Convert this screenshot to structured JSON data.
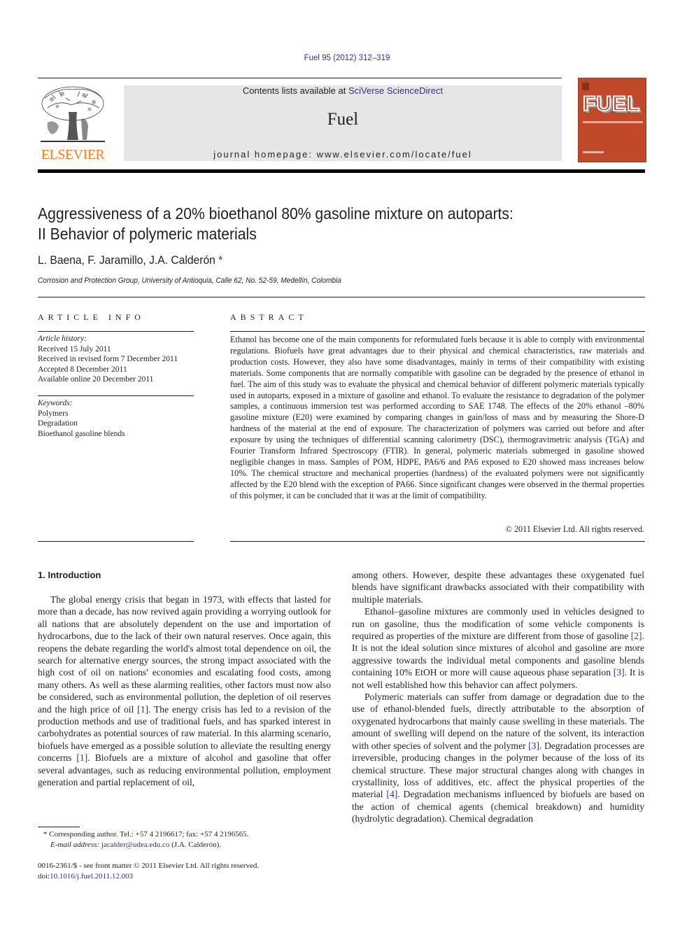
{
  "header": {
    "citation": "Fuel 95 (2012) 312–319",
    "contents_prefix": "Contents lists available at ",
    "contents_link": "SciVerse ScienceDirect",
    "journal_name": "Fuel",
    "homepage_prefix": "journal homepage: ",
    "homepage_url": "www.elsevier.com/locate/fuel",
    "publisher_logo_text": "ELSEVIER",
    "cover_title": "FUEL",
    "colors": {
      "publisher_orange": "#f58220",
      "cover_red": "#c0492a",
      "link_blue": "#2e3092"
    }
  },
  "article": {
    "title_line1": "Aggressiveness of a 20% bioethanol 80% gasoline mixture on autoparts:",
    "title_line2": "II Behavior of polymeric materials",
    "authors": "L. Baena, F. Jaramillo, J.A. Calderón",
    "author_mark": "*",
    "affiliation": "Corrosion and Protection Group, University of Antioquia, Calle 62, No. 52-59, Medellín, Colombia"
  },
  "article_info": {
    "heading": "ARTICLE INFO",
    "history_label": "Article history:",
    "history": [
      "Received 15 July 2011",
      "Received in revised form 7 December 2011",
      "Accepted 8 December 2011",
      "Available online 20 December 2011"
    ],
    "keywords_label": "Keywords:",
    "keywords": [
      "Polymers",
      "Degradation",
      "Bioethanol gasoline blends"
    ]
  },
  "abstract": {
    "heading": "ABSTRACT",
    "text": "Ethanol has become one of the main components for reformulated fuels because it is able to comply with environmental regulations. Biofuels have great advantages due to their physical and chemical characteristics, raw materials and production costs. However, they also have some disadvantages, mainly in terms of their compatibility with existing materials. Some components that are normally compatible with gasoline can be degraded by the presence of ethanol in fuel. The aim of this study was to evaluate the physical and chemical behavior of different polymeric materials typically used in autoparts, exposed in a mixture of gasoline and ethanol. To evaluate the resistance to degradation of the polymer samples, a continuous immersion test was performed according to SAE 1748. The effects of the 20% ethanol –80% gasoline mixture (E20) were examined by comparing changes in gain/loss of mass and by measuring the Shore-D hardness of the material at the end of exposure. The characterization of polymers was carried out before and after exposure by using the techniques of differential scanning calorimetry (DSC), thermogravimetric analysis (TGA) and Fourier Transform Infrared Spectroscopy (FTIR). In general, polymeric materials submerged in gasoline showed negligible changes in mass. Samples of POM, HDPE, PA6/6 and PA6 exposed to E20 showed mass increases below 10%. The chemical structure and mechanical properties (hardness) of the evaluated polymers were not significantly affected by the E20 blend with the exception of PA66. Since significant changes were observed in the thermal properties of this polymer, it can be concluded that it was at the limit of compatibility.",
    "copyright": "© 2011 Elsevier Ltd. All rights reserved."
  },
  "body": {
    "section_heading": "1. Introduction",
    "left_p1_a": "The global energy crisis that began in 1973, with effects that lasted for more than a decade, has now revived again providing a worrying outlook for all nations that are absolutely dependent on the use and importation of hydrocarbons, due to the lack of their own natural reserves. Once again, this reopens the debate regarding the world's almost total dependence on oil, the search for alternative energy sources, the strong impact associated with the high cost of oil on nations' economies and escalating food costs, among many others. As well as these alarming realities, other factors must now also be considered, such as environmental pollution, the depletion of oil reserves and the high price of oil ",
    "ref1": "[1]",
    "left_p1_b": ". The energy crisis has led to a revision of the production methods and use of traditional fuels, and has sparked interest in carbohydrates as potential sources of raw material. In this alarming scenario, biofuels have emerged as a possible solution to alleviate the resulting energy concerns ",
    "left_p1_c": ". Biofuels are a mixture of alcohol and gasoline that offer several advantages, such as reducing environmental pollution, employment generation and partial replacement of oil,",
    "right_p1": "among others. However, despite these advantages these oxygenated fuel blends have significant drawbacks associated with their compatibility with multiple materials.",
    "right_p2_a": "Ethanol–gasoline mixtures are commonly used in vehicles designed to run on gasoline, thus the modification of some vehicle components is required as properties of the mixture are different from those of gasoline ",
    "ref2": "[2]",
    "right_p2_b": ". It is not the ideal solution since mixtures of alcohol and gasoline are more aggressive towards the individual metal components and gasoline blends containing 10% EtOH or more will cause aqueous phase separation ",
    "ref3": "[3]",
    "right_p2_c": ". It is not well established how this behavior can affect polymers.",
    "right_p3_a": "Polymeric materials can suffer from damage or degradation due to the use of ethanol-blended fuels, directly attributable to the absorption of oxygenated hydrocarbons that mainly cause swelling in these materials. The amount of swelling will depend on the nature of the solvent, its interaction with other species of solvent and the polymer ",
    "right_p3_b": ". Degradation processes are irreversible, producing changes in the polymer because of the loss of its chemical structure. These major structural changes along with changes in crystallinity, loss of additives, etc. affect the physical properties of the material ",
    "ref4": "[4]",
    "right_p3_c": ". Degradation mechanisms influenced by biofuels are based on the action of chemical agents (chemical breakdown) and humidity (hydrolytic degradation). Chemical degradation"
  },
  "footnote": {
    "mark": "*",
    "corresponding": " Corresponding author. Tel.: +57 4 2196617; fax: +57 4 2196565.",
    "email_label": "E-mail address:",
    "email": "jacalder@udea.edu.co",
    "email_suffix": " (J.A. Calderón)."
  },
  "front_matter": {
    "issn_line": "0016-2361/$ - see front matter © 2011 Elsevier Ltd. All rights reserved.",
    "doi_prefix": "doi:",
    "doi": "10.1016/j.fuel.2011.12.003"
  }
}
